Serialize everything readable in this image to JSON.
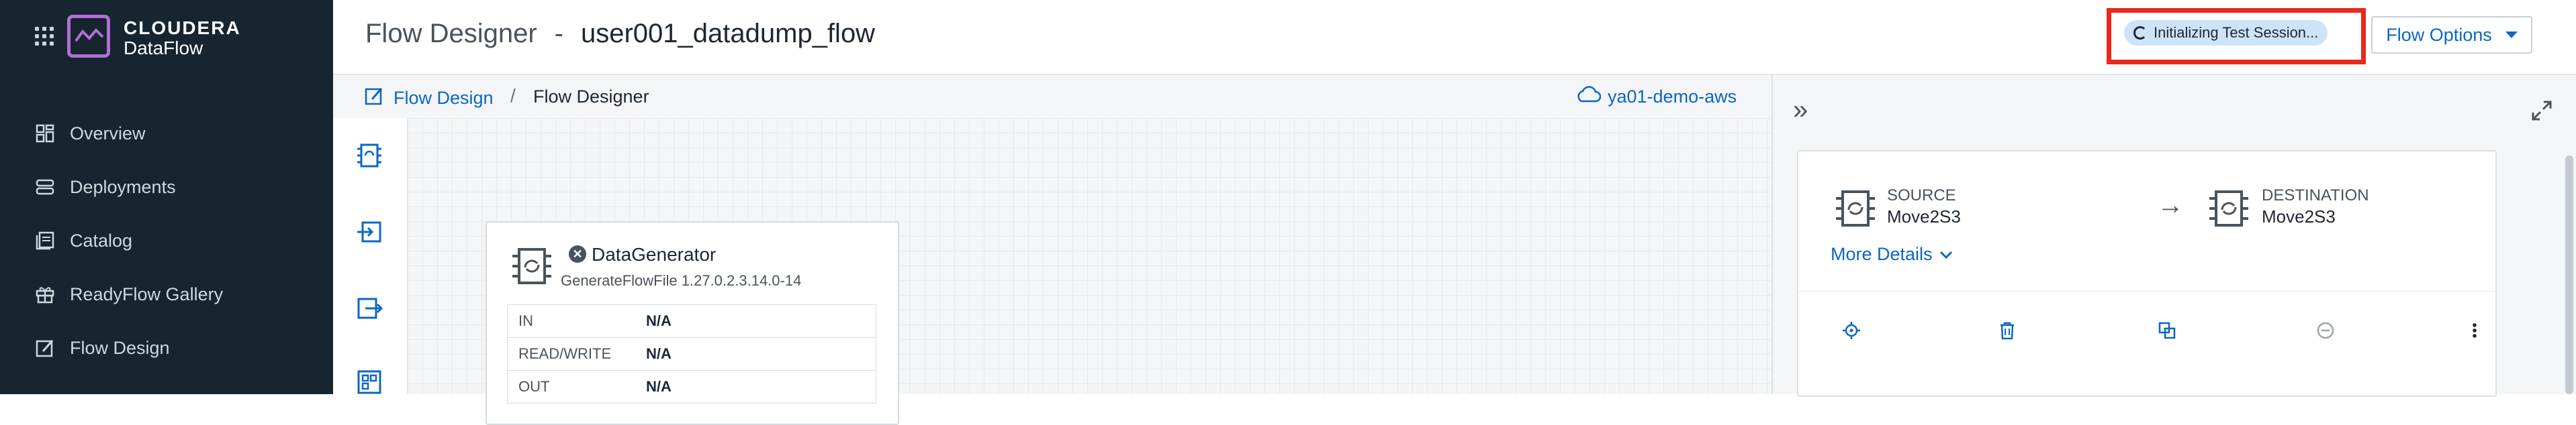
{
  "brand": {
    "line1": "CLOUDERA",
    "line2": "DataFlow",
    "accent": "#b06fd6"
  },
  "sidebar": {
    "items": [
      {
        "label": "Overview",
        "icon": "overview-icon"
      },
      {
        "label": "Deployments",
        "icon": "deployments-icon"
      },
      {
        "label": "Catalog",
        "icon": "catalog-icon"
      },
      {
        "label": "ReadyFlow Gallery",
        "icon": "gift-icon"
      },
      {
        "label": "Flow Design",
        "icon": "flow-design-icon"
      }
    ]
  },
  "header": {
    "title": "Flow Designer",
    "separator": "-",
    "flow_name": "user001_datadump_flow",
    "status": "Initializing Test Session...",
    "flow_options": "Flow Options"
  },
  "breadcrumb": {
    "root": "Flow Design",
    "sep": "/",
    "current": "Flow Designer"
  },
  "environment": "ya01-demo-aws",
  "palette": [
    "processor-icon",
    "input-port-icon",
    "output-port-icon",
    "process-group-icon"
  ],
  "processor": {
    "name": "DataGenerator",
    "type": "GenerateFlowFile 1.27.0.2.3.14.0-14",
    "status_icon": "invalid-icon",
    "stats": [
      {
        "key": "IN",
        "value": "N/A"
      },
      {
        "key": "READ/WRITE",
        "value": "N/A"
      },
      {
        "key": "OUT",
        "value": "N/A"
      }
    ]
  },
  "connection": {
    "source_label": "SOURCE",
    "source_name": "Move2S3",
    "destination_label": "DESTINATION",
    "destination_name": "Move2S3",
    "more_details": "More Details",
    "actions": [
      "locate-icon",
      "delete-icon",
      "copy-icon",
      "disable-icon",
      "more-icon"
    ]
  },
  "colors": {
    "link": "#0a67c4",
    "sidebar_bg": "#16252f",
    "highlight": "#e8291c",
    "status_bg": "#cde3f7"
  }
}
